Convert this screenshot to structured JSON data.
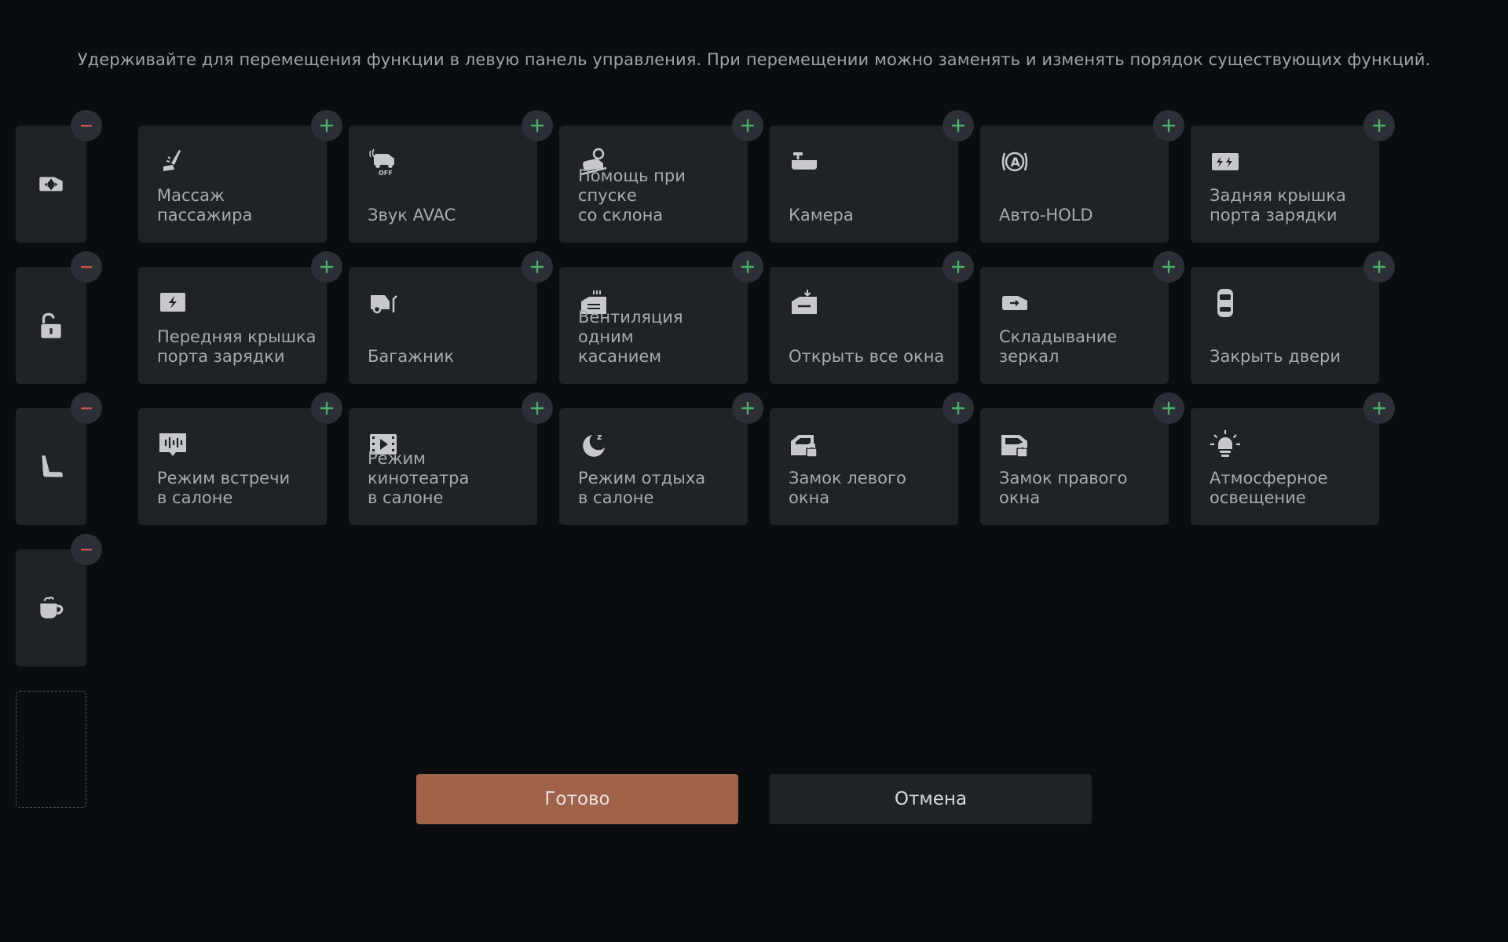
{
  "hint": "Удерживайте для перемещения функции в левую панель управления. При перемещении можно заменять и изменять порядок существующих функций.",
  "colors": {
    "background": "#0a0d10",
    "tile": "#1f2227",
    "accent": "#a1624a",
    "add": "#4cae6b",
    "remove": "#c9574f"
  },
  "quick_panel": [
    {
      "icon": "mirror-adjust-icon"
    },
    {
      "icon": "unlock-icon"
    },
    {
      "icon": "seat-icon"
    },
    {
      "icon": "coffee-cup-icon"
    }
  ],
  "functions": [
    {
      "label": "Массаж пассажира",
      "icon": "seat-massage-icon"
    },
    {
      "label": "Звук AVAC",
      "icon": "avac-sound-off-icon"
    },
    {
      "label": "Помощь при спуске\nсо склона",
      "icon": "hill-descent-icon"
    },
    {
      "label": "Камера",
      "icon": "camera-icon"
    },
    {
      "label": "Авто-HOLD",
      "icon": "auto-hold-icon"
    },
    {
      "label": "Задняя крышка\nпорта зарядки",
      "icon": "rear-charge-port-icon"
    },
    {
      "label": "Передняя крышка\nпорта зарядки",
      "icon": "front-charge-port-icon"
    },
    {
      "label": "Багажник",
      "icon": "trunk-icon"
    },
    {
      "label": "Вентиляция одним\nкасанием",
      "icon": "one-touch-ventilation-icon"
    },
    {
      "label": "Открыть все окна",
      "icon": "open-all-windows-icon"
    },
    {
      "label": "Складывание\nзеркал",
      "icon": "mirror-fold-icon"
    },
    {
      "label": "Закрыть двери",
      "icon": "lock-doors-icon"
    },
    {
      "label": "Режим встречи\nв салоне",
      "icon": "meeting-mode-icon"
    },
    {
      "label": "Режим кинотеатра\nв салоне",
      "icon": "cinema-mode-icon"
    },
    {
      "label": "Режим отдыха\nв салоне",
      "icon": "rest-mode-icon"
    },
    {
      "label": "Замок левого\nокна",
      "icon": "left-window-lock-icon"
    },
    {
      "label": "Замок правого\nокна",
      "icon": "right-window-lock-icon"
    },
    {
      "label": "Атмосферное\nосвещение",
      "icon": "ambient-light-icon"
    }
  ],
  "buttons": {
    "done": "Готово",
    "cancel": "Отмена"
  }
}
